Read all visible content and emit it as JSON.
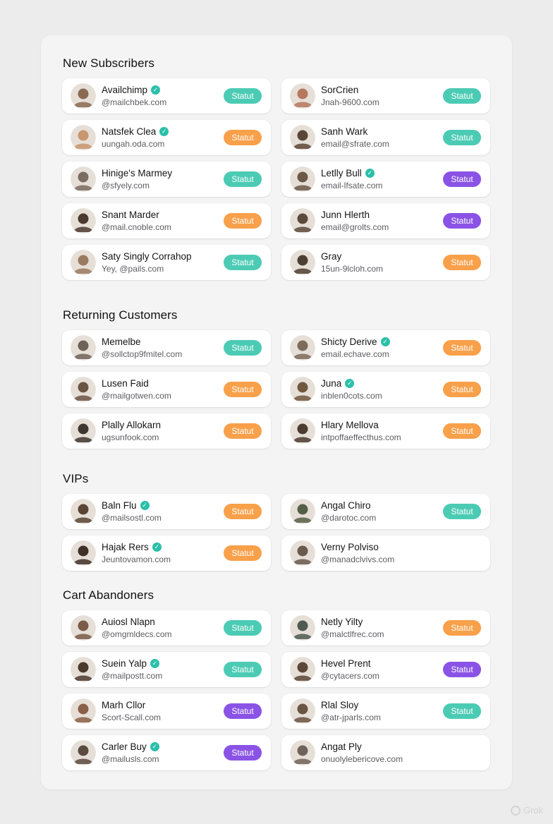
{
  "badge_label": "Statut",
  "colors": {
    "teal": "#4ccbb4",
    "orange": "#f8a04a",
    "purple": "#8a53e6",
    "verified": "#2bbfa9"
  },
  "watermark": "Grok",
  "sections": [
    {
      "title": "New Subscribers",
      "contacts": [
        {
          "name": "Availchimp",
          "email": "@mailchbek.com",
          "verified": true,
          "status": "teal",
          "avatar_color": "#8a6a52"
        },
        {
          "name": "SorCrien",
          "email": "Jnah-9600.com",
          "verified": false,
          "status": "teal",
          "avatar_color": "#b5785e"
        },
        {
          "name": "Natsfek Clea",
          "email": "uungah.oda.com",
          "verified": true,
          "status": "orange",
          "avatar_color": "#c89670"
        },
        {
          "name": "Sanh Wark",
          "email": "email@sfrate.com",
          "verified": false,
          "status": "teal",
          "avatar_color": "#5a4636"
        },
        {
          "name": "Hinige's Marmey",
          "email": "@sfyely.com",
          "verified": false,
          "status": "teal",
          "avatar_color": "#7b6c62"
        },
        {
          "name": "Letlly Bull",
          "email": "email-lfsate.com",
          "verified": true,
          "status": "purple",
          "avatar_color": "#6b5848"
        },
        {
          "name": "Snant Marder",
          "email": "@mail.cnoble.com",
          "verified": false,
          "status": "orange",
          "avatar_color": "#4a3a30"
        },
        {
          "name": "Junn Hlerth",
          "email": "email@grolts.com",
          "verified": false,
          "status": "purple",
          "avatar_color": "#5c4a3c"
        },
        {
          "name": "Saty Singly Corrahop",
          "email": "Yey, @pails.com",
          "verified": false,
          "status": "teal",
          "avatar_color": "#9a7a60"
        },
        {
          "name": "Gray",
          "email": "15un-9lcloh.com",
          "verified": false,
          "status": "orange",
          "avatar_color": "#4d3f33"
        }
      ]
    },
    {
      "title": "Returning Customers",
      "contacts": [
        {
          "name": "Memelbe",
          "email": "@sollctop9fmitel.com",
          "verified": false,
          "status": "teal",
          "avatar_color": "#6e6258"
        },
        {
          "name": "Shicty Derive",
          "email": "email.echave.com",
          "verified": true,
          "status": "orange",
          "avatar_color": "#7c6b5a"
        },
        {
          "name": "Lusen Faid",
          "email": "@mailgotwen.com",
          "verified": false,
          "status": "orange",
          "avatar_color": "#6a5444"
        },
        {
          "name": "Juna",
          "email": "inblen0cots.com",
          "verified": true,
          "status": "orange",
          "avatar_color": "#70583f"
        },
        {
          "name": "Plally Allokarn",
          "email": "ugsunfook.com",
          "verified": false,
          "status": "orange",
          "avatar_color": "#3e3630"
        },
        {
          "name": "Hlary Mellova",
          "email": "intpoffaeffecthus.com",
          "verified": false,
          "status": "orange",
          "avatar_color": "#4b3b30"
        }
      ]
    },
    {
      "title": "VIPs",
      "contacts": [
        {
          "name": "Baln Flu",
          "email": "@mailsostl.com",
          "verified": true,
          "status": "orange",
          "avatar_color": "#5a4434"
        },
        {
          "name": "Angal Chiro",
          "email": "@darotoc.com",
          "verified": false,
          "status": "teal",
          "avatar_color": "#556048"
        },
        {
          "name": "Hajak Rers",
          "email": "Jeuntovamon.com",
          "verified": true,
          "status": "orange",
          "avatar_color": "#3f3028"
        },
        {
          "name": "Verny Polviso",
          "email": "@manadclvivs.com",
          "verified": false,
          "status": null,
          "avatar_color": "#6a5a4e"
        }
      ]
    },
    {
      "title": "Cart Abandoners",
      "contacts": [
        {
          "name": "Auiosl Nlapn",
          "email": "@omgmldecs.com",
          "verified": false,
          "status": "teal",
          "avatar_color": "#7a5a48"
        },
        {
          "name": "Netly Yilty",
          "email": "@malctlfrec.com",
          "verified": false,
          "status": "orange",
          "avatar_color": "#4e5a52"
        },
        {
          "name": "Suein Yalp",
          "email": "@mailpostt.com",
          "verified": true,
          "status": "teal",
          "avatar_color": "#4a3a2e"
        },
        {
          "name": "Hevel Prent",
          "email": "@cytacers.com",
          "verified": false,
          "status": "purple",
          "avatar_color": "#5c4838"
        },
        {
          "name": "Marh Cllor",
          "email": "Scort-Scall.com",
          "verified": false,
          "status": "purple",
          "avatar_color": "#8a6048"
        },
        {
          "name": "Rlal Sloy",
          "email": "@atr-jparls.com",
          "verified": false,
          "status": "teal",
          "avatar_color": "#6a5444"
        },
        {
          "name": "Carler Buy",
          "email": "@mailusls.com",
          "verified": true,
          "status": "purple",
          "avatar_color": "#5a4a40"
        },
        {
          "name": "Angat Ply",
          "email": "onuolylebericove.com",
          "verified": false,
          "status": null,
          "avatar_color": "#6e625a"
        }
      ]
    }
  ]
}
